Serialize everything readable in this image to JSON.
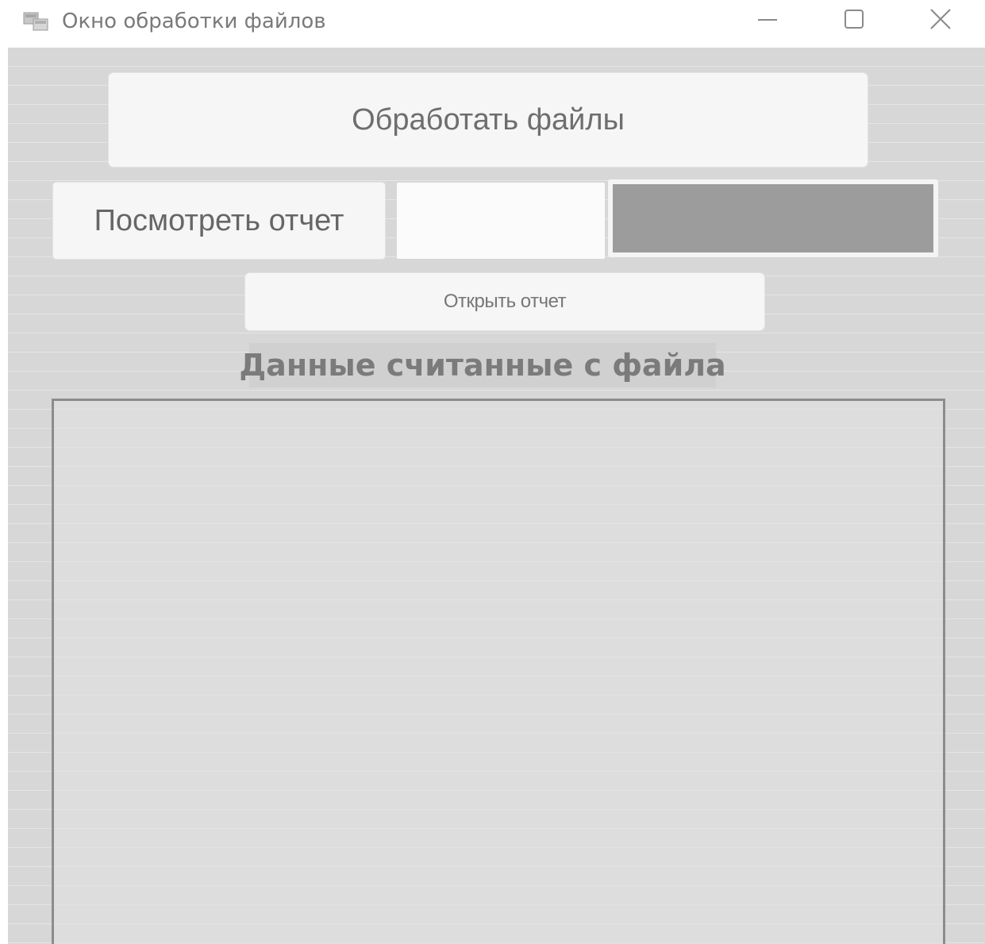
{
  "window": {
    "title": "Окно обработки файлов",
    "icon": "app-window-icon",
    "controls": {
      "minimize": "minimize-icon",
      "maximize": "maximize-icon",
      "close": "close-icon"
    }
  },
  "main": {
    "process_button_label": "Обработать файлы",
    "view_report_button_label": "Посмотреть отчет",
    "report_field_value": "",
    "progress": 1.0,
    "open_report_button_label": "Открыть отчет",
    "data_section_label": "Данные считанные с файла",
    "data_text": ""
  },
  "colors": {
    "background": "#d7d7d7",
    "button": "#f6f6f6",
    "progress_fill": "#9c9c9c",
    "text": "#6e6e6e"
  }
}
